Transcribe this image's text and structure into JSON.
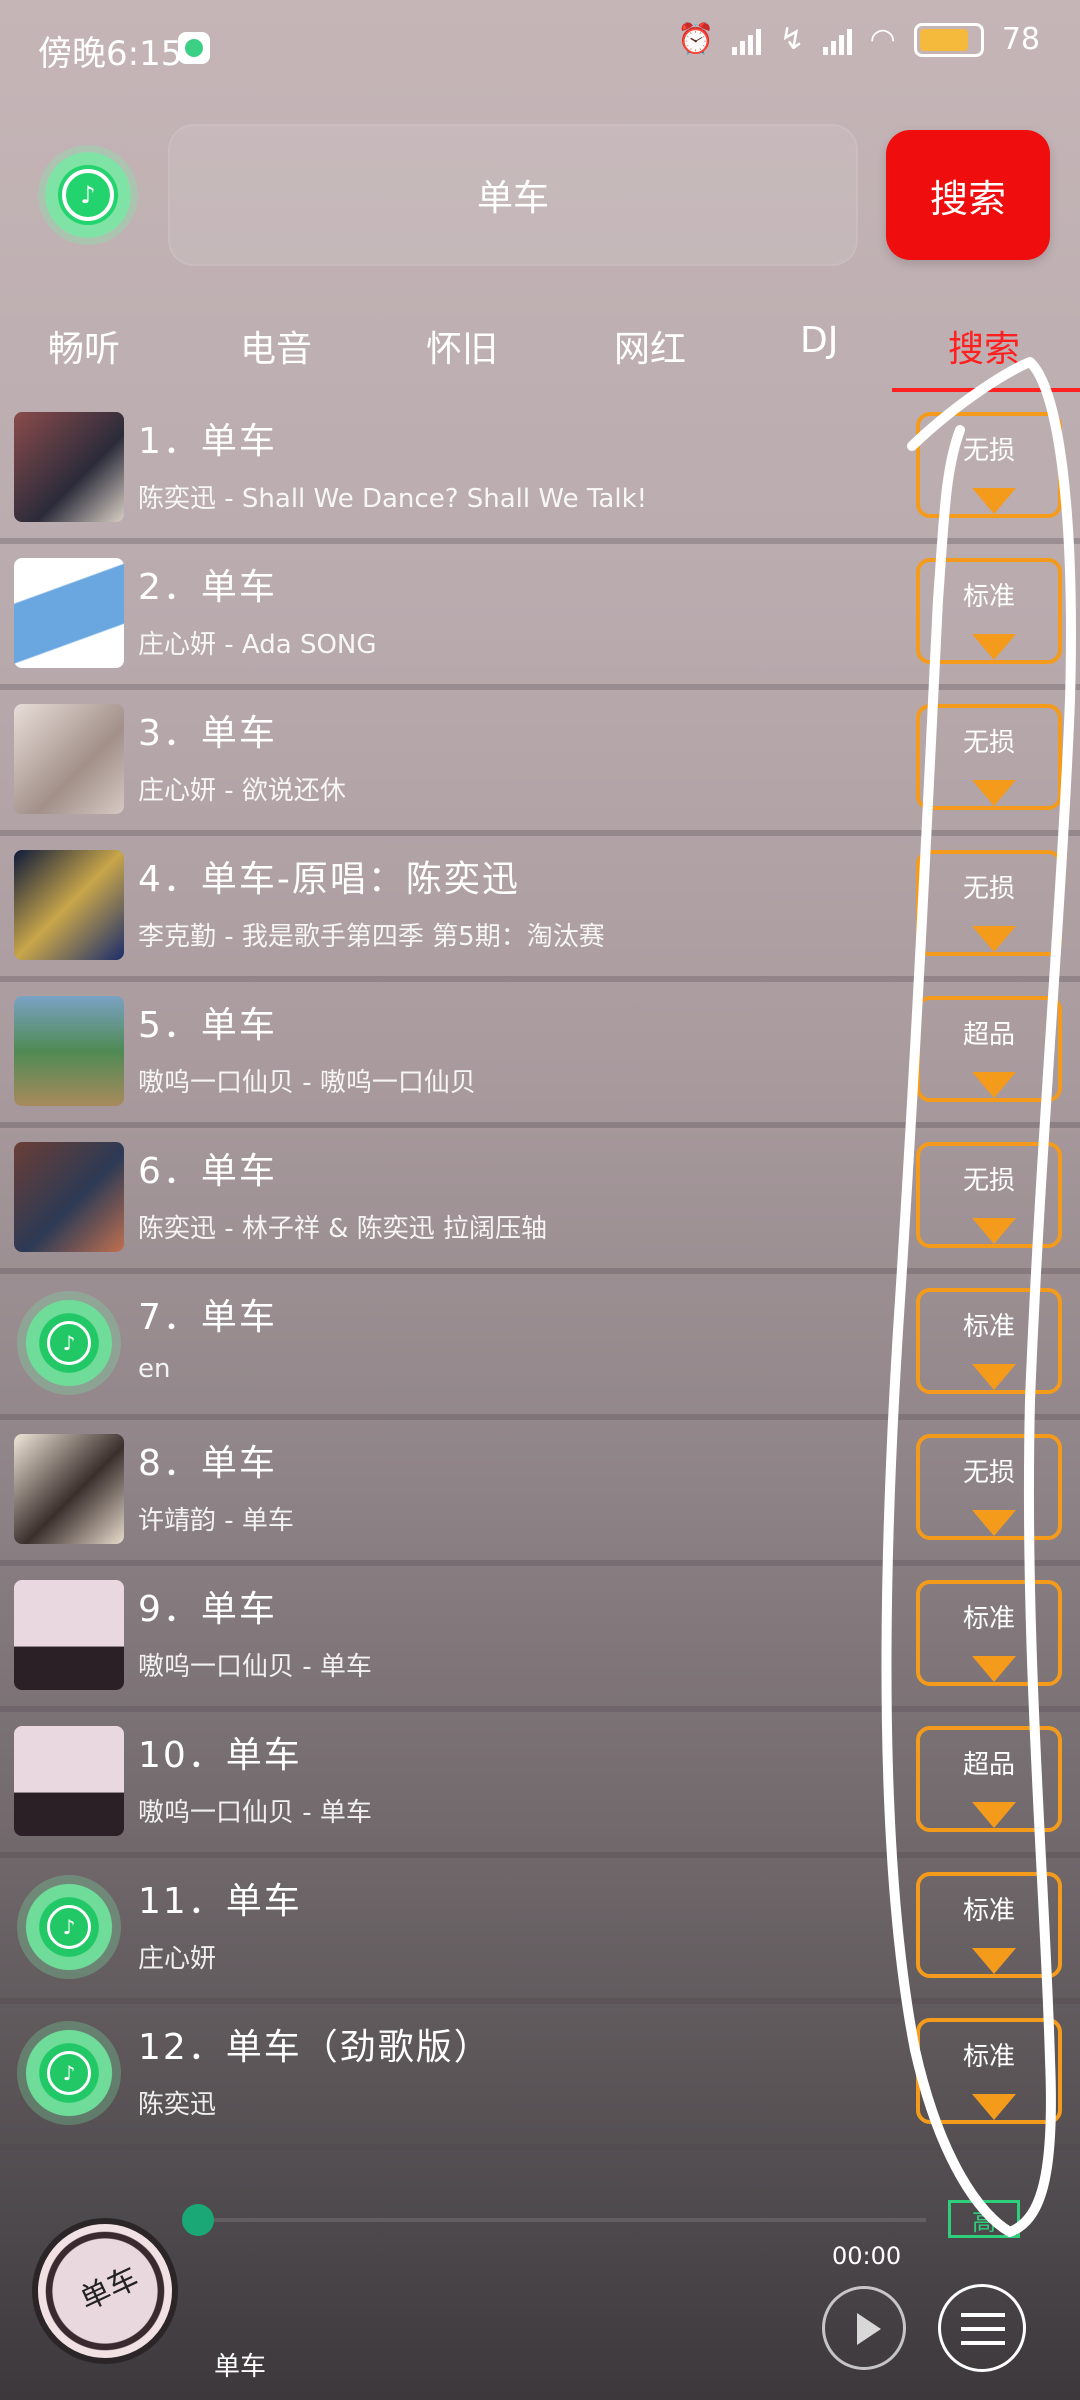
{
  "status_bar": {
    "time": "傍晚6:15",
    "battery": "78"
  },
  "search": {
    "query": "单车",
    "button": "搜索"
  },
  "tabs": [
    "畅听",
    "电音",
    "怀旧",
    "网红",
    "DJ",
    "搜索"
  ],
  "results": [
    {
      "title": "1．单车",
      "subtitle": "陈奕迅 - Shall We Dance? Shall We Talk!",
      "quality": "无损",
      "cover": "photo"
    },
    {
      "title": "2．单车",
      "subtitle": "庄心妍 - Ada SONG",
      "quality": "标准",
      "cover": "photo"
    },
    {
      "title": "3．单车",
      "subtitle": "庄心妍 - 欲说还休",
      "quality": "无损",
      "cover": "photo"
    },
    {
      "title": "4．单车-原唱：陈奕迅",
      "subtitle": "李克勤 - 我是歌手第四季 第5期：淘汰赛",
      "quality": "无损",
      "cover": "photo"
    },
    {
      "title": "5．单车",
      "subtitle": "嗷呜一口仙贝 - 嗷呜一口仙贝",
      "quality": "超品",
      "cover": "photo"
    },
    {
      "title": "6．单车",
      "subtitle": "陈奕迅 - 林子祥 & 陈奕迅 拉阔压轴",
      "quality": "无损",
      "cover": "photo"
    },
    {
      "title": "7．单车",
      "subtitle": "en",
      "quality": "标准",
      "cover": "default"
    },
    {
      "title": "8．单车",
      "subtitle": "许靖韵 - 单车",
      "quality": "无损",
      "cover": "photo"
    },
    {
      "title": "9．单车",
      "subtitle": "嗷呜一口仙贝 - 单车",
      "quality": "标准",
      "cover": "photo"
    },
    {
      "title": "10．单车",
      "subtitle": "嗷呜一口仙贝 - 单车",
      "quality": "超品",
      "cover": "photo"
    },
    {
      "title": "11．单车",
      "subtitle": "庄心妍",
      "quality": "标准",
      "cover": "default"
    },
    {
      "title": "12．单车（劲歌版）",
      "subtitle": "陈奕迅",
      "quality": "标准",
      "cover": "default"
    }
  ],
  "player": {
    "song": "单车",
    "time": "00:00",
    "quality_badge": "高"
  },
  "colors": {
    "accent": "#f00d0d",
    "quality_border": "#f59b1c",
    "brand_green": "#23d36e"
  }
}
